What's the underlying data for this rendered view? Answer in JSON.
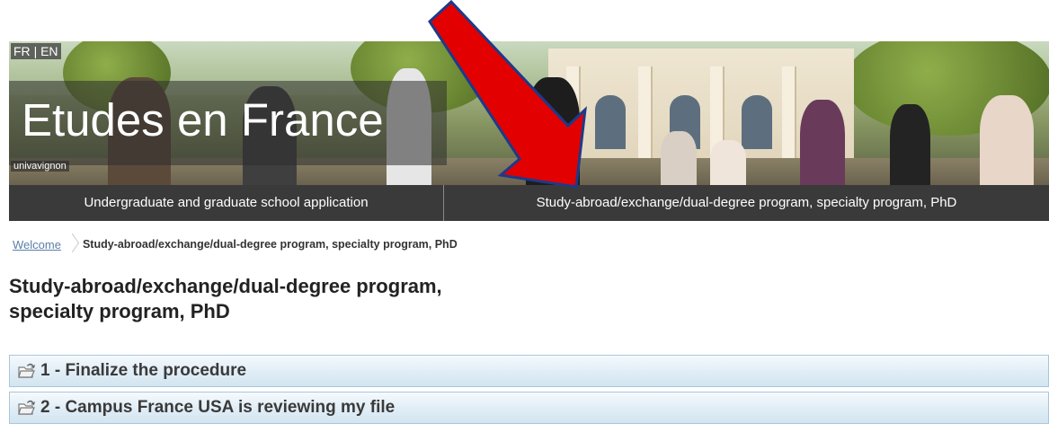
{
  "header": {
    "lang_fr": "FR",
    "lang_sep": "|",
    "lang_en": "EN",
    "site_title": "Etudes en France",
    "institution": "univavignon"
  },
  "nav": {
    "items": [
      {
        "label": "Undergraduate and graduate school application"
      },
      {
        "label": "Study-abroad/exchange/dual-degree program, specialty program, PhD"
      }
    ]
  },
  "breadcrumb": {
    "home": "Welcome",
    "current": "Study-abroad/exchange/dual-degree program, specialty program, PhD"
  },
  "page": {
    "title_line1": "Study-abroad/exchange/dual-degree program,",
    "title_line2": "specialty program, PhD"
  },
  "steps": [
    {
      "label": "1 - Finalize the procedure",
      "icon": "folder-arrow-icon"
    },
    {
      "label": "2 - Campus France USA is reviewing my file",
      "icon": "folder-arrow-icon"
    }
  ],
  "colors": {
    "nav_bg": "#3a3a3a",
    "step_border": "#a9c6db",
    "link": "#5a7fa8",
    "annotation_arrow": "#e30000"
  }
}
